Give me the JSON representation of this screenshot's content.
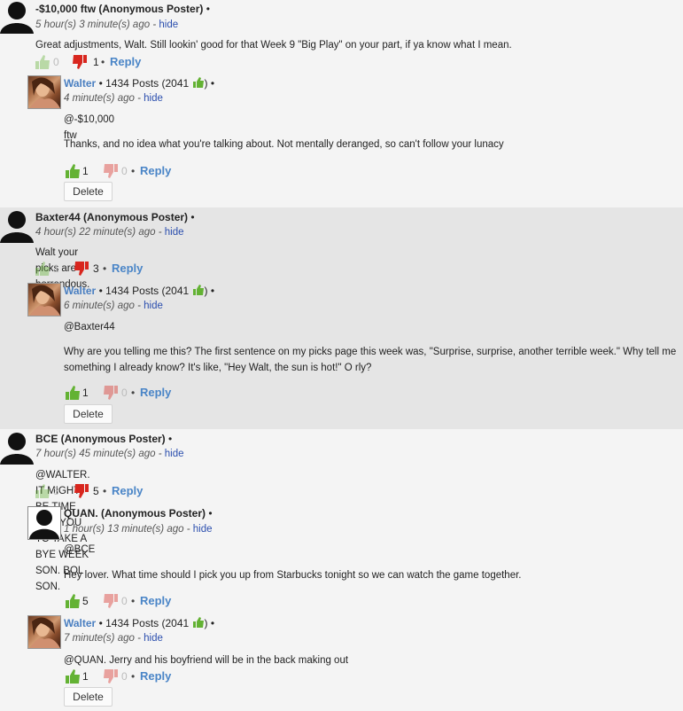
{
  "icons": {
    "anon_avatar": "person-silhouette",
    "user_avatar": "walter-profile-photo",
    "thumbs_up": "thumbs-up-icon",
    "thumbs_down": "thumbs-down-icon"
  },
  "colors": {
    "accent": "#4a85c7",
    "link": "#2c4fae",
    "thumb_up": "#63b233",
    "thumb_down": "#d8261e"
  },
  "threads": [
    {
      "name": "-$10,000 ftw (Anonymous Poster)",
      "bullet": "•",
      "time": "5 hour(s) 3 minute(s) ago",
      "sep": "-",
      "hide": "hide",
      "body": "Great adjustments, Walt. Still lookin' good for that Week 9 \"Big Play\" on your part, if ya know what I mean.",
      "up": "0",
      "down": "1",
      "reply": "Reply",
      "replies": [
        {
          "name": "Walter",
          "posts": "1434 Posts (2041",
          "close": ")",
          "bullet": "•",
          "time": "4 minute(s) ago",
          "sep": "-",
          "hide": "hide",
          "mention": "@-$10,000 ftw",
          "body": "Thanks, and no idea what you're talking about. Not mentally deranged, so can't follow your lunacy",
          "up": "1",
          "down": "0",
          "reply": "Reply",
          "delete": "Delete"
        }
      ]
    },
    {
      "name": "Baxter44 (Anonymous Poster)",
      "bullet": "•",
      "time": "4 hour(s) 22 minute(s) ago",
      "sep": "-",
      "hide": "hide",
      "body": "Walt your picks are horrendous.",
      "up": "1",
      "down": "3",
      "reply": "Reply",
      "replies": [
        {
          "name": "Walter",
          "posts": "1434 Posts (2041",
          "close": ")",
          "bullet": "•",
          "time": "6 minute(s) ago",
          "sep": "-",
          "hide": "hide",
          "mention": "@Baxter44",
          "body": "Why are you telling me this? The first sentence on my picks page this week was, \"Surprise, surprise, another terrible week.\" Why tell me something I already know? It's like, \"Hey Walt, the sun is hot!\" O rly?",
          "up": "1",
          "down": "0",
          "reply": "Reply",
          "delete": "Delete"
        }
      ]
    },
    {
      "name": "BCE (Anonymous Poster)",
      "bullet": "•",
      "time": "7 hour(s) 45 minute(s) ago",
      "sep": "-",
      "hide": "hide",
      "body": "@WALTER. IT MIGHT BE TIME FOR YOU TO TAKE A BYE WEEK SON. BOL SON.",
      "up": "3",
      "down": "5",
      "reply": "Reply",
      "replies": [
        {
          "name": "QUAN. (Anonymous Poster)",
          "bullet": "•",
          "time": "1 hour(s) 13 minute(s) ago",
          "sep": "-",
          "hide": "hide",
          "mention": "@BCE",
          "body": "Hey lover. What time should I pick you up from Starbucks tonight so we can watch the game together.",
          "up": "5",
          "down": "0",
          "reply": "Reply"
        },
        {
          "name": "Walter",
          "posts": "1434 Posts (2041",
          "close": ")",
          "bullet": "•",
          "time": "7 minute(s) ago",
          "sep": "-",
          "hide": "hide",
          "body": "@QUAN. Jerry and his boyfriend will be in the back making out",
          "up": "1",
          "down": "0",
          "reply": "Reply",
          "delete": "Delete"
        }
      ]
    }
  ]
}
